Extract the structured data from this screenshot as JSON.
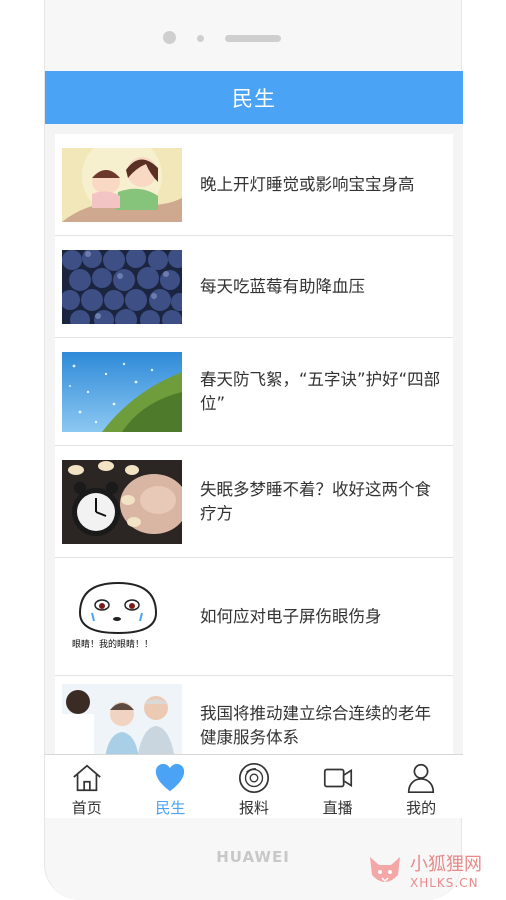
{
  "app": {
    "title": "民生"
  },
  "articles": [
    {
      "title": "晚上开灯睡觉或影响宝宝身高",
      "image": "baby-sleeping-illustration"
    },
    {
      "title": "每天吃蓝莓有助降血压",
      "image": "blueberries-photo"
    },
    {
      "title": "春天防飞絮，“五字诀”护好“四部位”",
      "image": "catkins-tree-photo"
    },
    {
      "title": "失眠多梦睡不着？收好这两个食疗方",
      "image": "alarm-clock-sheep-photo"
    },
    {
      "title": "如何应对电子屏伤眼伤身",
      "image": "crying-meme-face",
      "image_caption": "眼睛！我的眼睛！！"
    },
    {
      "title": "我国将推动建立综合连续的老年健康服务体系",
      "image": "doctor-elderly-couple-photo"
    }
  ],
  "tabbar": [
    {
      "label": "首页",
      "icon": "home-icon",
      "active": false
    },
    {
      "label": "民生",
      "icon": "heart-icon",
      "active": true
    },
    {
      "label": "报料",
      "icon": "disc-icon",
      "active": false
    },
    {
      "label": "直播",
      "icon": "video-camera-icon",
      "active": false
    },
    {
      "label": "我的",
      "icon": "user-icon",
      "active": false
    }
  ],
  "device": {
    "brand": "HUAWEI"
  },
  "watermark": {
    "name_cn": "小狐狸网",
    "domain": "XHLKS.CN"
  },
  "colors": {
    "accent": "#4aa3f4",
    "text": "#333333",
    "divider": "#e2e2e2"
  }
}
